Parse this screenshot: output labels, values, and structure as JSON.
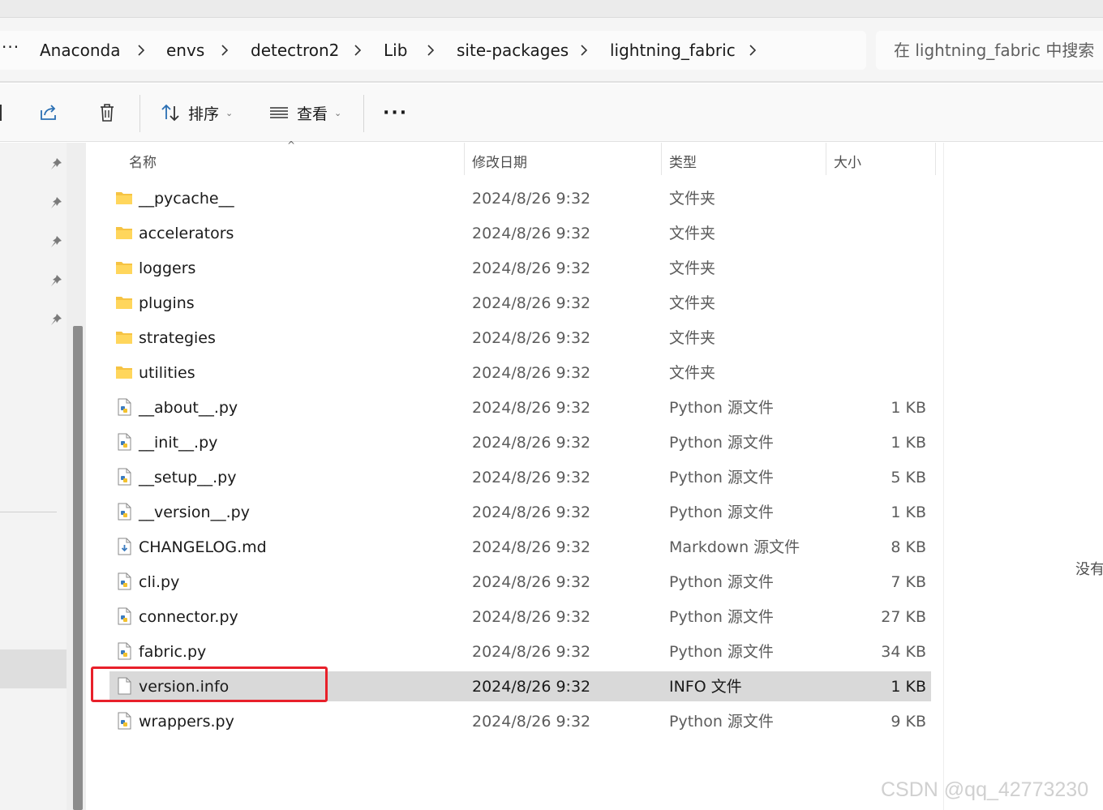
{
  "address_bar": {
    "overflow_label": "···",
    "breadcrumbs": [
      "Anaconda",
      "envs",
      "detectron2",
      "Lib",
      "site-packages",
      "lightning_fabric"
    ],
    "search_placeholder": "在 lightning_fabric 中搜索"
  },
  "toolbar": {
    "share_icon": "share-icon",
    "delete_icon": "trash-icon",
    "sort_label": "排序",
    "view_label": "查看",
    "more_label": "···"
  },
  "columns": {
    "name": "名称",
    "modified": "修改日期",
    "type": "类型",
    "size": "大小"
  },
  "files": [
    {
      "name": "__pycache__",
      "date": "2024/8/26 9:32",
      "type": "文件夹",
      "size": "",
      "icon": "folder-icon"
    },
    {
      "name": "accelerators",
      "date": "2024/8/26 9:32",
      "type": "文件夹",
      "size": "",
      "icon": "folder-icon"
    },
    {
      "name": "loggers",
      "date": "2024/8/26 9:32",
      "type": "文件夹",
      "size": "",
      "icon": "folder-icon"
    },
    {
      "name": "plugins",
      "date": "2024/8/26 9:32",
      "type": "文件夹",
      "size": "",
      "icon": "folder-icon"
    },
    {
      "name": "strategies",
      "date": "2024/8/26 9:32",
      "type": "文件夹",
      "size": "",
      "icon": "folder-icon"
    },
    {
      "name": "utilities",
      "date": "2024/8/26 9:32",
      "type": "文件夹",
      "size": "",
      "icon": "folder-icon"
    },
    {
      "name": "__about__.py",
      "date": "2024/8/26 9:32",
      "type": "Python 源文件",
      "size": "1 KB",
      "icon": "python-file-icon"
    },
    {
      "name": "__init__.py",
      "date": "2024/8/26 9:32",
      "type": "Python 源文件",
      "size": "1 KB",
      "icon": "python-file-icon"
    },
    {
      "name": "__setup__.py",
      "date": "2024/8/26 9:32",
      "type": "Python 源文件",
      "size": "5 KB",
      "icon": "python-file-icon"
    },
    {
      "name": "__version__.py",
      "date": "2024/8/26 9:32",
      "type": "Python 源文件",
      "size": "1 KB",
      "icon": "python-file-icon"
    },
    {
      "name": "CHANGELOG.md",
      "date": "2024/8/26 9:32",
      "type": "Markdown 源文件",
      "size": "8 KB",
      "icon": "markdown-file-icon"
    },
    {
      "name": "cli.py",
      "date": "2024/8/26 9:32",
      "type": "Python 源文件",
      "size": "7 KB",
      "icon": "python-file-icon"
    },
    {
      "name": "connector.py",
      "date": "2024/8/26 9:32",
      "type": "Python 源文件",
      "size": "27 KB",
      "icon": "python-file-icon"
    },
    {
      "name": "fabric.py",
      "date": "2024/8/26 9:32",
      "type": "Python 源文件",
      "size": "34 KB",
      "icon": "python-file-icon"
    },
    {
      "name": "version.info",
      "date": "2024/8/26 9:32",
      "type": "INFO 文件",
      "size": "1 KB",
      "icon": "blank-file-icon",
      "selected": true
    },
    {
      "name": "wrappers.py",
      "date": "2024/8/26 9:32",
      "type": "Python 源文件",
      "size": "9 KB",
      "icon": "python-file-icon"
    }
  ],
  "preview_pane": {
    "message": "没有"
  },
  "watermark": "CSDN @qq_42773230",
  "colors": {
    "selection": "#d9d9d9",
    "highlight_border": "#e8202a",
    "folder": "#f6c343",
    "python_blue": "#3b7bbf"
  }
}
